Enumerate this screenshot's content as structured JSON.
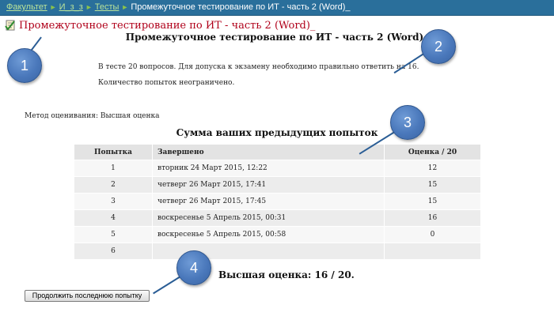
{
  "breadcrumb": {
    "items": [
      "Факультет",
      "И_з_з",
      "Тесты",
      "Промежуточное тестирование по ИТ - часть 2 (Word)_"
    ],
    "separator": "►"
  },
  "quiz_link": {
    "label": "Промежуточное тестирование по ИТ - часть 2 (Word)_",
    "icon": "quiz-icon"
  },
  "main": {
    "title": "Промежуточное тестирование по ИТ - часть 2 (Word)_",
    "intro_lines": [
      "В тесте 20 вопросов. Для допуска к экзамену необходимо правильно ответить на 16.",
      "Количество попыток неограничено."
    ],
    "grading_method": "Метод оценивания: Высшая оценка",
    "summary_title": "Сумма ваших предыдущих попыток",
    "table": {
      "headers": [
        "Попытка",
        "Завершено",
        "Оценка / 20"
      ],
      "rows": [
        [
          "1",
          "вторник 24 Март 2015, 12:22",
          "12"
        ],
        [
          "2",
          "четверг 26 Март 2015, 17:41",
          "15"
        ],
        [
          "3",
          "четверг 26 Март 2015, 17:45",
          "15"
        ],
        [
          "4",
          "воскресенье 5 Апрель 2015, 00:31",
          "16"
        ],
        [
          "5",
          "воскресенье 5 Апрель 2015, 00:58",
          "0"
        ],
        [
          "6",
          "",
          ""
        ]
      ]
    },
    "best_grade": "Высшая оценка: 16 / 20.",
    "continue_button": "Продолжить последнюю попытку"
  },
  "markers": [
    "1",
    "2",
    "3",
    "4"
  ],
  "colors": {
    "navbar": "#2a6f9b",
    "link": "#b0001a",
    "marker": "#4a78bb"
  }
}
